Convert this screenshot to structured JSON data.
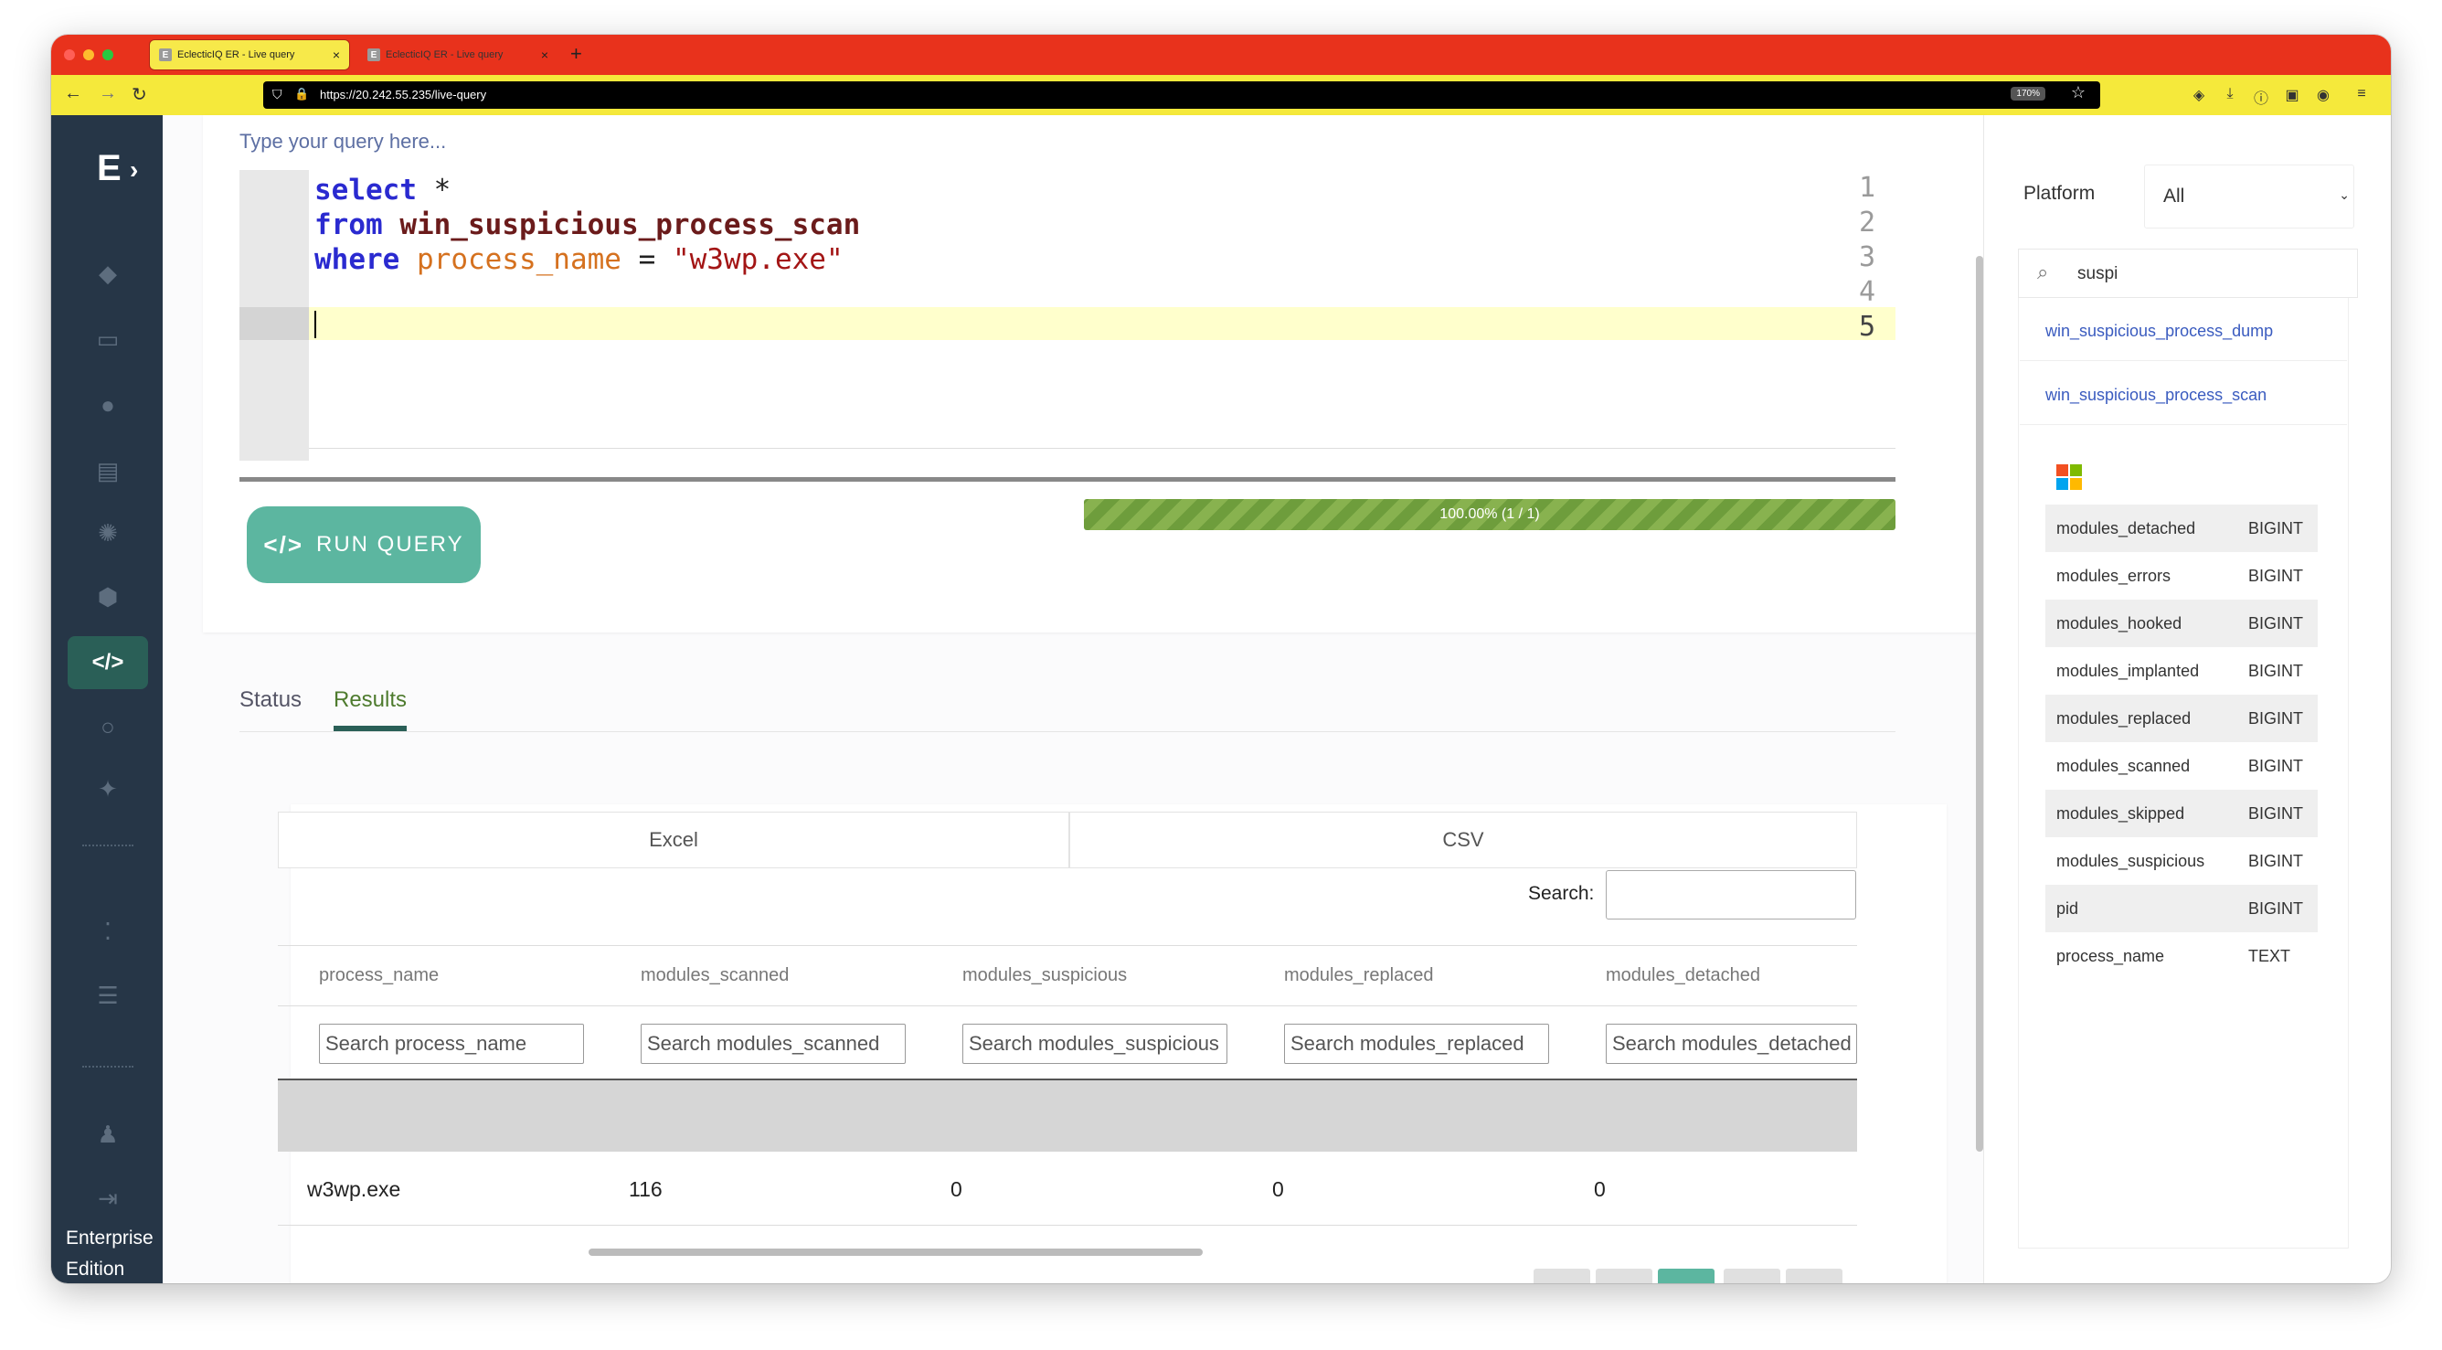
{
  "browser": {
    "tabs": [
      {
        "title": "EclecticIQ ER - Live query",
        "active": true
      },
      {
        "title": "EclecticIQ ER - Live query",
        "active": false
      }
    ],
    "url": "https://20.242.55.235/live-query",
    "zoom": "170%"
  },
  "sidebar": {
    "logo": "E",
    "edition_line1": "Enterprise",
    "edition_line2": "Edition",
    "active_item": "live-query"
  },
  "editor": {
    "placeholder": "Type your query here...",
    "line_numbers": [
      "1",
      "2",
      "3",
      "4",
      "5"
    ],
    "line1_kw": "select",
    "line1_rest": " *",
    "line2_kw": "from",
    "line2_table": " win_suspicious_process_scan",
    "line3_kw": "where",
    "line3_col": " process_name",
    "line3_op": " = ",
    "line3_str": "\"w3wp.exe\""
  },
  "run_button": {
    "label": "RUN QUERY"
  },
  "progress": {
    "text": "100.00% (1 / 1)",
    "fraction": 1.0
  },
  "result_tabs": {
    "status": "Status",
    "results": "Results",
    "active": "Results"
  },
  "export": {
    "excel": "Excel",
    "csv": "CSV"
  },
  "table": {
    "search_label": "Search:",
    "search_value": "",
    "columns": [
      "process_name",
      "modules_scanned",
      "modules_suspicious",
      "modules_replaced",
      "modules_detached"
    ],
    "column_search_placeholders": [
      "Search process_name",
      "Search modules_scanned",
      "Search modules_suspicious",
      "Search modules_replaced",
      "Search modules_detached"
    ],
    "rows": [
      [
        "w3wp.exe",
        "116",
        "0",
        "0",
        "0"
      ]
    ]
  },
  "right_panel": {
    "platform_label": "Platform",
    "platform_value": "All",
    "search_value": "suspi",
    "tables": [
      "win_suspicious_process_dump",
      "win_suspicious_process_scan"
    ],
    "schema": [
      {
        "name": "modules_detached",
        "type": "BIGINT"
      },
      {
        "name": "modules_errors",
        "type": "BIGINT"
      },
      {
        "name": "modules_hooked",
        "type": "BIGINT"
      },
      {
        "name": "modules_implanted",
        "type": "BIGINT"
      },
      {
        "name": "modules_replaced",
        "type": "BIGINT"
      },
      {
        "name": "modules_scanned",
        "type": "BIGINT"
      },
      {
        "name": "modules_skipped",
        "type": "BIGINT"
      },
      {
        "name": "modules_suspicious",
        "type": "BIGINT"
      },
      {
        "name": "pid",
        "type": "BIGINT"
      },
      {
        "name": "process_name",
        "type": "TEXT"
      }
    ]
  },
  "colors": {
    "tabbar": "#e8321c",
    "urlbar": "#f5e93b",
    "sidebar": "#263647",
    "accent": "#5cb6a0",
    "progress": "#6e9d3c",
    "results_tab": "#4e7b2e"
  }
}
